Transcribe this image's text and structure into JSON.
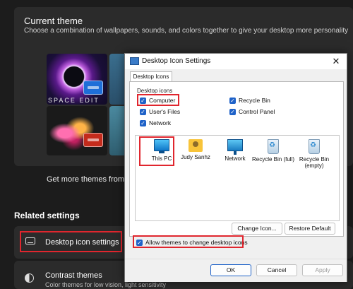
{
  "settings": {
    "current_theme_title": "Current theme",
    "current_theme_subtitle": "Choose a combination of wallpapers, sounds, and colors together to give your desktop more personality",
    "space_theme_label": "SPACE EDIT",
    "get_more_themes": "Get more themes from M",
    "related_settings": "Related settings",
    "desktop_icon_settings": "Desktop icon settings",
    "contrast_themes": "Contrast themes",
    "contrast_themes_sub": "Color themes for low vision, light sensitivity"
  },
  "dialog": {
    "title": "Desktop Icon Settings",
    "close_glyph": "✕",
    "tab": "Desktop Icons",
    "group_label": "Desktop icons",
    "checkboxes": {
      "computer": "Computer",
      "users_files": "User's Files",
      "network": "Network",
      "recycle_bin": "Recycle Bin",
      "control_panel": "Control Panel"
    },
    "icons": {
      "this_pc": "This PC",
      "judy": "Judy Sanhz",
      "network": "Network",
      "recycle_full": "Recycle Bin (full)",
      "recycle_empty": "Recycle Bin (empty)"
    },
    "change_icon": "Change Icon...",
    "restore_default": "Restore Default",
    "allow_themes": "Allow themes to change desktop icons",
    "ok": "OK",
    "cancel": "Cancel",
    "apply": "Apply"
  },
  "colors": {
    "highlight": "#e0262e",
    "checkbox": "#1f62c8",
    "accent_badge": "#1e6ed8",
    "red_badge": "#c42b1c"
  },
  "icon_names": [
    "monitor-icon",
    "user-folder-icon",
    "network-icon",
    "recycle-bin-full-icon",
    "recycle-bin-empty-icon",
    "desktop-icon",
    "contrast-icon"
  ]
}
